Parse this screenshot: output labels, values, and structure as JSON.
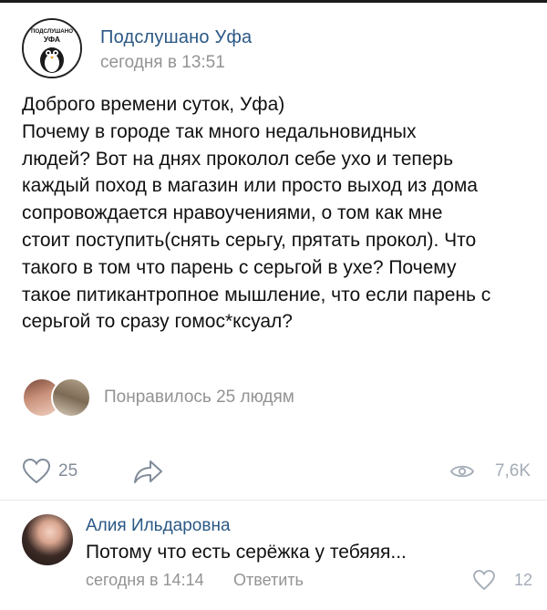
{
  "post": {
    "community_name": "Подслушано Уфа",
    "avatar_text_top": "ПОДСЛУШАНО",
    "avatar_text_city": "УФА",
    "time": "сегодня в 13:51",
    "lines": [
      "Доброго времени суток, Уфа)",
      "Почему в городе так много недальновидных",
      "людей? Вот на днях проколол себе ухо и теперь",
      "каждый поход в магазин или просто выход из дома",
      "сопровождается нравоучениями, о том как мне",
      "стоит поступить(снять серьгу, прятать прокол). Что",
      "такого в том что парень с серьгой в ухе? Почему",
      "такое питикантропное мышление, что если парень с",
      "серьгой то сразу гомос*ксуал?"
    ],
    "likes_text": "Понравилось 25 людям",
    "like_count": "25",
    "views_count": "7,6K"
  },
  "comment": {
    "author": "Алия Ильдаровна",
    "text": "Потому что есть серёжка у тебяяя...",
    "time": "сегодня в 14:14",
    "reply_label": "Ответить",
    "like_count": "12"
  },
  "colors": {
    "link": "#2a5885",
    "secondary": "#939393",
    "icon": "#818c99"
  },
  "icons": {
    "like": "heart-outline-icon",
    "share": "share-arrow-icon",
    "views": "eye-icon"
  }
}
